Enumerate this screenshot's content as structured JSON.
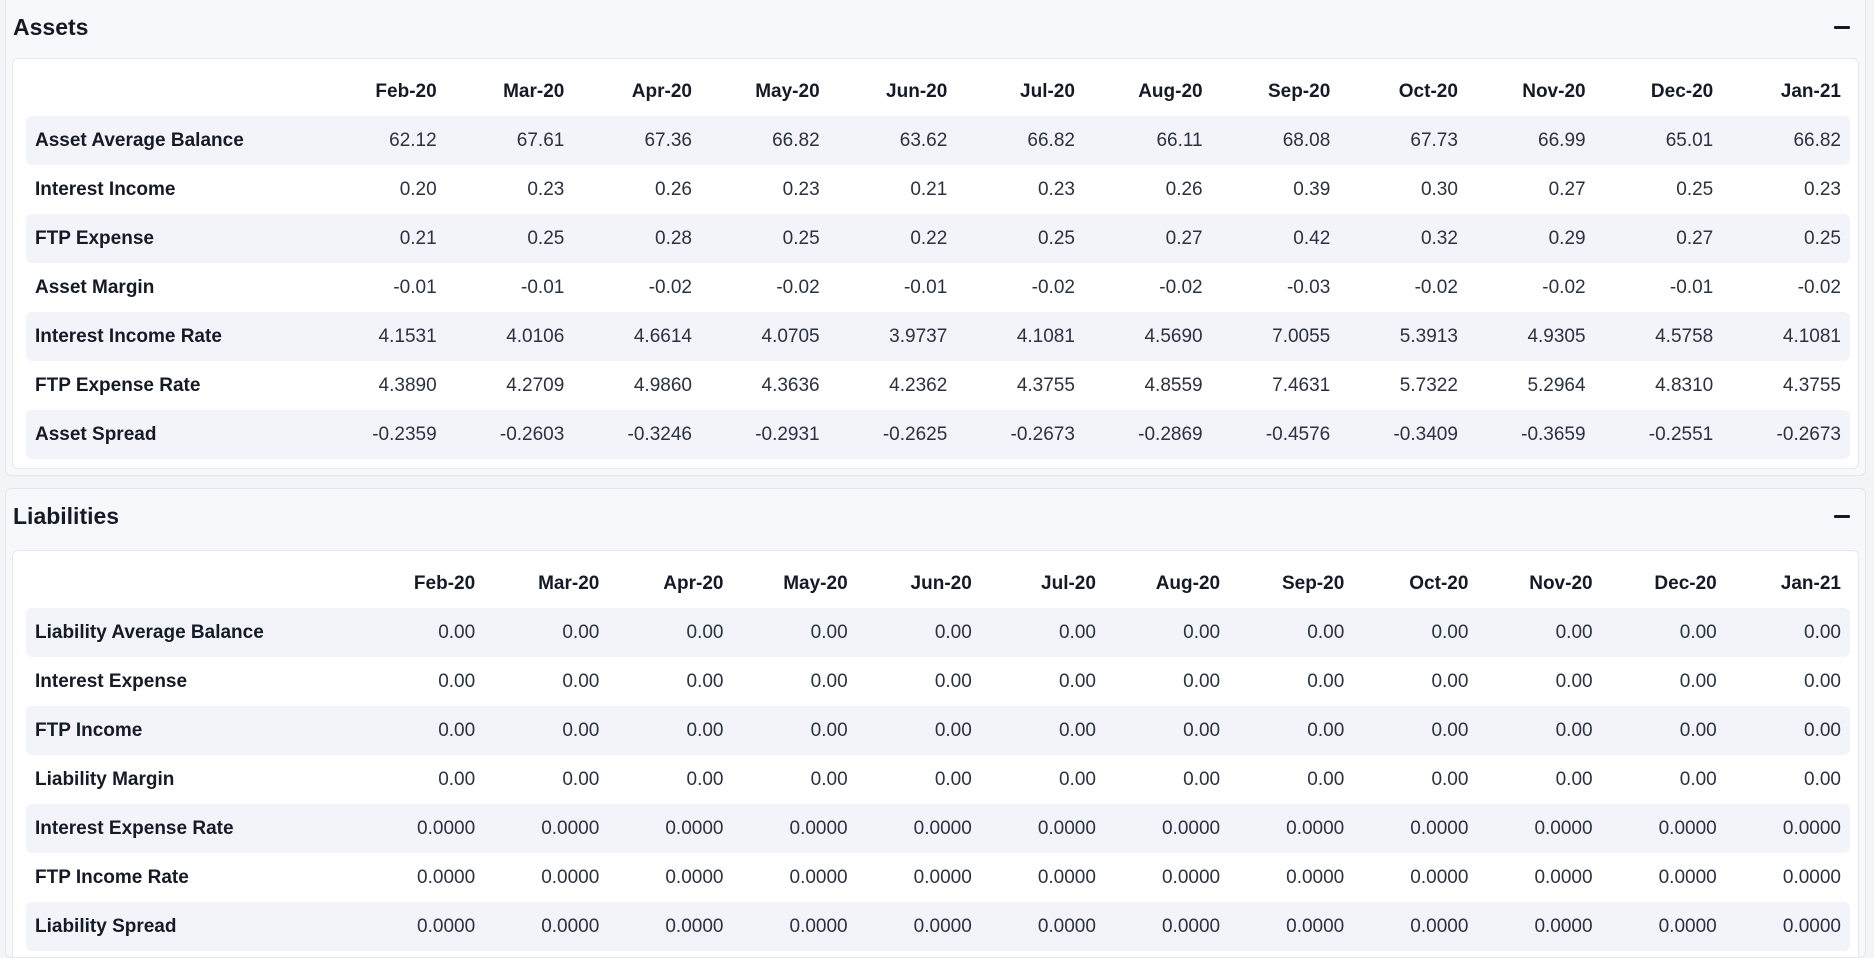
{
  "assets": {
    "title": "Assets",
    "months": [
      "Feb-20",
      "Mar-20",
      "Apr-20",
      "May-20",
      "Jun-20",
      "Jul-20",
      "Aug-20",
      "Sep-20",
      "Oct-20",
      "Nov-20",
      "Dec-20",
      "Jan-21"
    ],
    "rows": [
      {
        "label": "Asset Average Balance",
        "values": [
          "62.12",
          "67.61",
          "67.36",
          "66.82",
          "63.62",
          "66.82",
          "66.11",
          "68.08",
          "67.73",
          "66.99",
          "65.01",
          "66.82"
        ]
      },
      {
        "label": "Interest Income",
        "values": [
          "0.20",
          "0.23",
          "0.26",
          "0.23",
          "0.21",
          "0.23",
          "0.26",
          "0.39",
          "0.30",
          "0.27",
          "0.25",
          "0.23"
        ]
      },
      {
        "label": "FTP Expense",
        "values": [
          "0.21",
          "0.25",
          "0.28",
          "0.25",
          "0.22",
          "0.25",
          "0.27",
          "0.42",
          "0.32",
          "0.29",
          "0.27",
          "0.25"
        ]
      },
      {
        "label": "Asset Margin",
        "values": [
          "-0.01",
          "-0.01",
          "-0.02",
          "-0.02",
          "-0.01",
          "-0.02",
          "-0.02",
          "-0.03",
          "-0.02",
          "-0.02",
          "-0.01",
          "-0.02"
        ]
      },
      {
        "label": "Interest Income Rate",
        "values": [
          "4.1531",
          "4.0106",
          "4.6614",
          "4.0705",
          "3.9737",
          "4.1081",
          "4.5690",
          "7.0055",
          "5.3913",
          "4.9305",
          "4.5758",
          "4.1081"
        ]
      },
      {
        "label": "FTP Expense Rate",
        "values": [
          "4.3890",
          "4.2709",
          "4.9860",
          "4.3636",
          "4.2362",
          "4.3755",
          "4.8559",
          "7.4631",
          "5.7322",
          "5.2964",
          "4.8310",
          "4.3755"
        ]
      },
      {
        "label": "Asset Spread",
        "values": [
          "-0.2359",
          "-0.2603",
          "-0.3246",
          "-0.2931",
          "-0.2625",
          "-0.2673",
          "-0.2869",
          "-0.4576",
          "-0.3409",
          "-0.3659",
          "-0.2551",
          "-0.2673"
        ]
      }
    ]
  },
  "liabilities": {
    "title": "Liabilities",
    "months": [
      "Feb-20",
      "Mar-20",
      "Apr-20",
      "May-20",
      "Jun-20",
      "Jul-20",
      "Aug-20",
      "Sep-20",
      "Oct-20",
      "Nov-20",
      "Dec-20",
      "Jan-21"
    ],
    "rows": [
      {
        "label": "Liability Average Balance",
        "values": [
          "0.00",
          "0.00",
          "0.00",
          "0.00",
          "0.00",
          "0.00",
          "0.00",
          "0.00",
          "0.00",
          "0.00",
          "0.00",
          "0.00"
        ]
      },
      {
        "label": "Interest Expense",
        "values": [
          "0.00",
          "0.00",
          "0.00",
          "0.00",
          "0.00",
          "0.00",
          "0.00",
          "0.00",
          "0.00",
          "0.00",
          "0.00",
          "0.00"
        ]
      },
      {
        "label": "FTP Income",
        "values": [
          "0.00",
          "0.00",
          "0.00",
          "0.00",
          "0.00",
          "0.00",
          "0.00",
          "0.00",
          "0.00",
          "0.00",
          "0.00",
          "0.00"
        ]
      },
      {
        "label": "Liability Margin",
        "values": [
          "0.00",
          "0.00",
          "0.00",
          "0.00",
          "0.00",
          "0.00",
          "0.00",
          "0.00",
          "0.00",
          "0.00",
          "0.00",
          "0.00"
        ]
      },
      {
        "label": "Interest Expense Rate",
        "values": [
          "0.0000",
          "0.0000",
          "0.0000",
          "0.0000",
          "0.0000",
          "0.0000",
          "0.0000",
          "0.0000",
          "0.0000",
          "0.0000",
          "0.0000",
          "0.0000"
        ]
      },
      {
        "label": "FTP Income Rate",
        "values": [
          "0.0000",
          "0.0000",
          "0.0000",
          "0.0000",
          "0.0000",
          "0.0000",
          "0.0000",
          "0.0000",
          "0.0000",
          "0.0000",
          "0.0000",
          "0.0000"
        ]
      },
      {
        "label": "Liability Spread",
        "values": [
          "0.0000",
          "0.0000",
          "0.0000",
          "0.0000",
          "0.0000",
          "0.0000",
          "0.0000",
          "0.0000",
          "0.0000",
          "0.0000",
          "0.0000",
          "0.0000"
        ]
      }
    ]
  },
  "icons": {
    "collapse": "minus-icon"
  }
}
